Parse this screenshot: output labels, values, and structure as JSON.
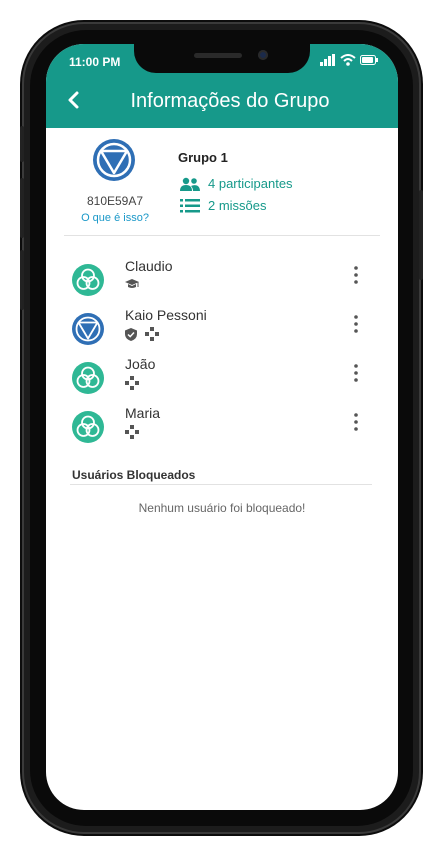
{
  "status_bar": {
    "time": "11:00 PM"
  },
  "header": {
    "title": "Informações do Grupo"
  },
  "group": {
    "code": "810E59A7",
    "what_is_this": "O que é isso?",
    "name": "Grupo 1",
    "participants": "4 participantes",
    "missions": "2 missões"
  },
  "members": [
    {
      "name": "Claudio",
      "avatar": "triangle-knot-avatar-teal",
      "icons": [
        "graduation-cap-icon"
      ]
    },
    {
      "name": "Kaio Pessoni",
      "avatar": "down-triangle-avatar-blue",
      "icons": [
        "shield-check-icon",
        "gamepad-icon"
      ]
    },
    {
      "name": "João",
      "avatar": "triangle-knot-avatar-teal",
      "icons": [
        "gamepad-icon"
      ]
    },
    {
      "name": "Maria",
      "avatar": "triangle-knot-avatar-teal",
      "icons": [
        "gamepad-icon"
      ]
    }
  ],
  "blocked": {
    "title": "Usuários Bloqueados",
    "empty_message": "Nenhum usuário foi bloqueado!"
  },
  "colors": {
    "primary": "#16998a",
    "link": "#1a98c8",
    "blue_avatar": "#2f6fb5",
    "teal_avatar": "#2fb895"
  }
}
